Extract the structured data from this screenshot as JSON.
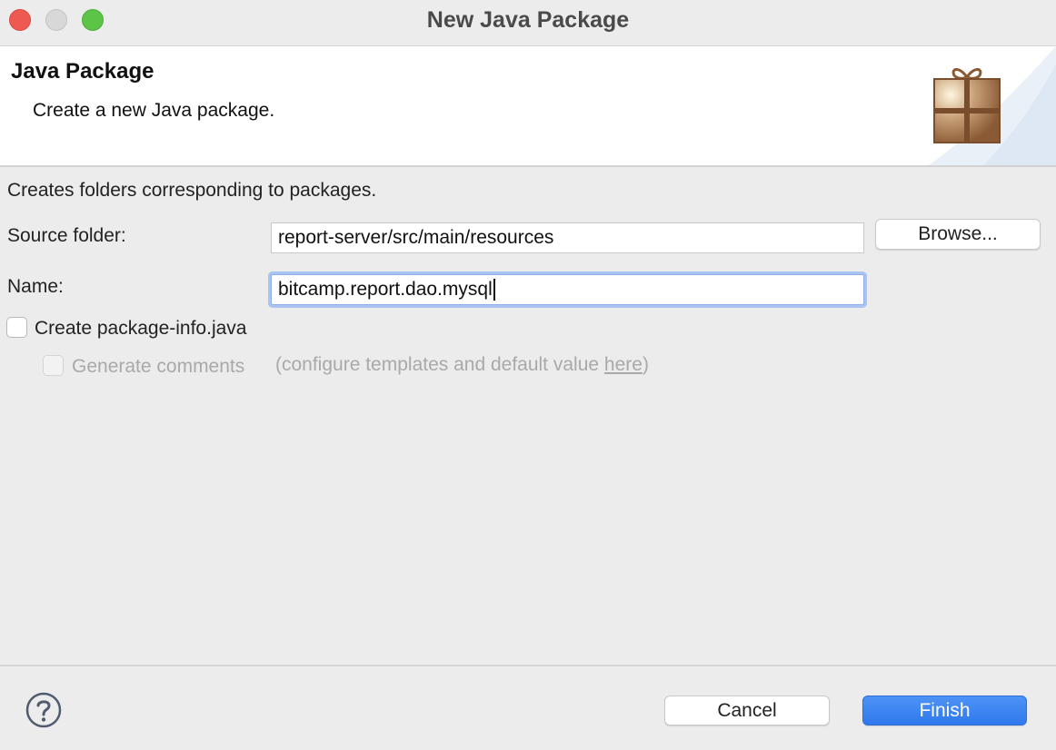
{
  "window": {
    "title": "New Java Package"
  },
  "banner": {
    "title": "Java Package",
    "description": "Create a new Java package.",
    "icon": "package-gift-icon"
  },
  "form": {
    "description": "Creates folders corresponding to packages.",
    "source_folder": {
      "label": "Source folder:",
      "value": "report-server/src/main/resources"
    },
    "name": {
      "label": "Name:",
      "value": "bitcamp.report.dao.mysql"
    },
    "browse_label": "Browse...",
    "create_package_info": {
      "label": "Create package-info.java",
      "checked": false
    },
    "generate_comments": {
      "label": "Generate comments",
      "checked": false,
      "enabled": false,
      "hint_prefix": "(configure templates and default value ",
      "hint_link": "here",
      "hint_suffix": ")"
    }
  },
  "footer": {
    "help_icon": "help-question-icon",
    "cancel_label": "Cancel",
    "finish_label": "Finish"
  },
  "colors": {
    "close": "#ee5a52",
    "minimize": "#d8d8d8",
    "maximize": "#5cc447",
    "focus_ring": "#a9c4f0",
    "primary_button": "#3a82f0"
  }
}
